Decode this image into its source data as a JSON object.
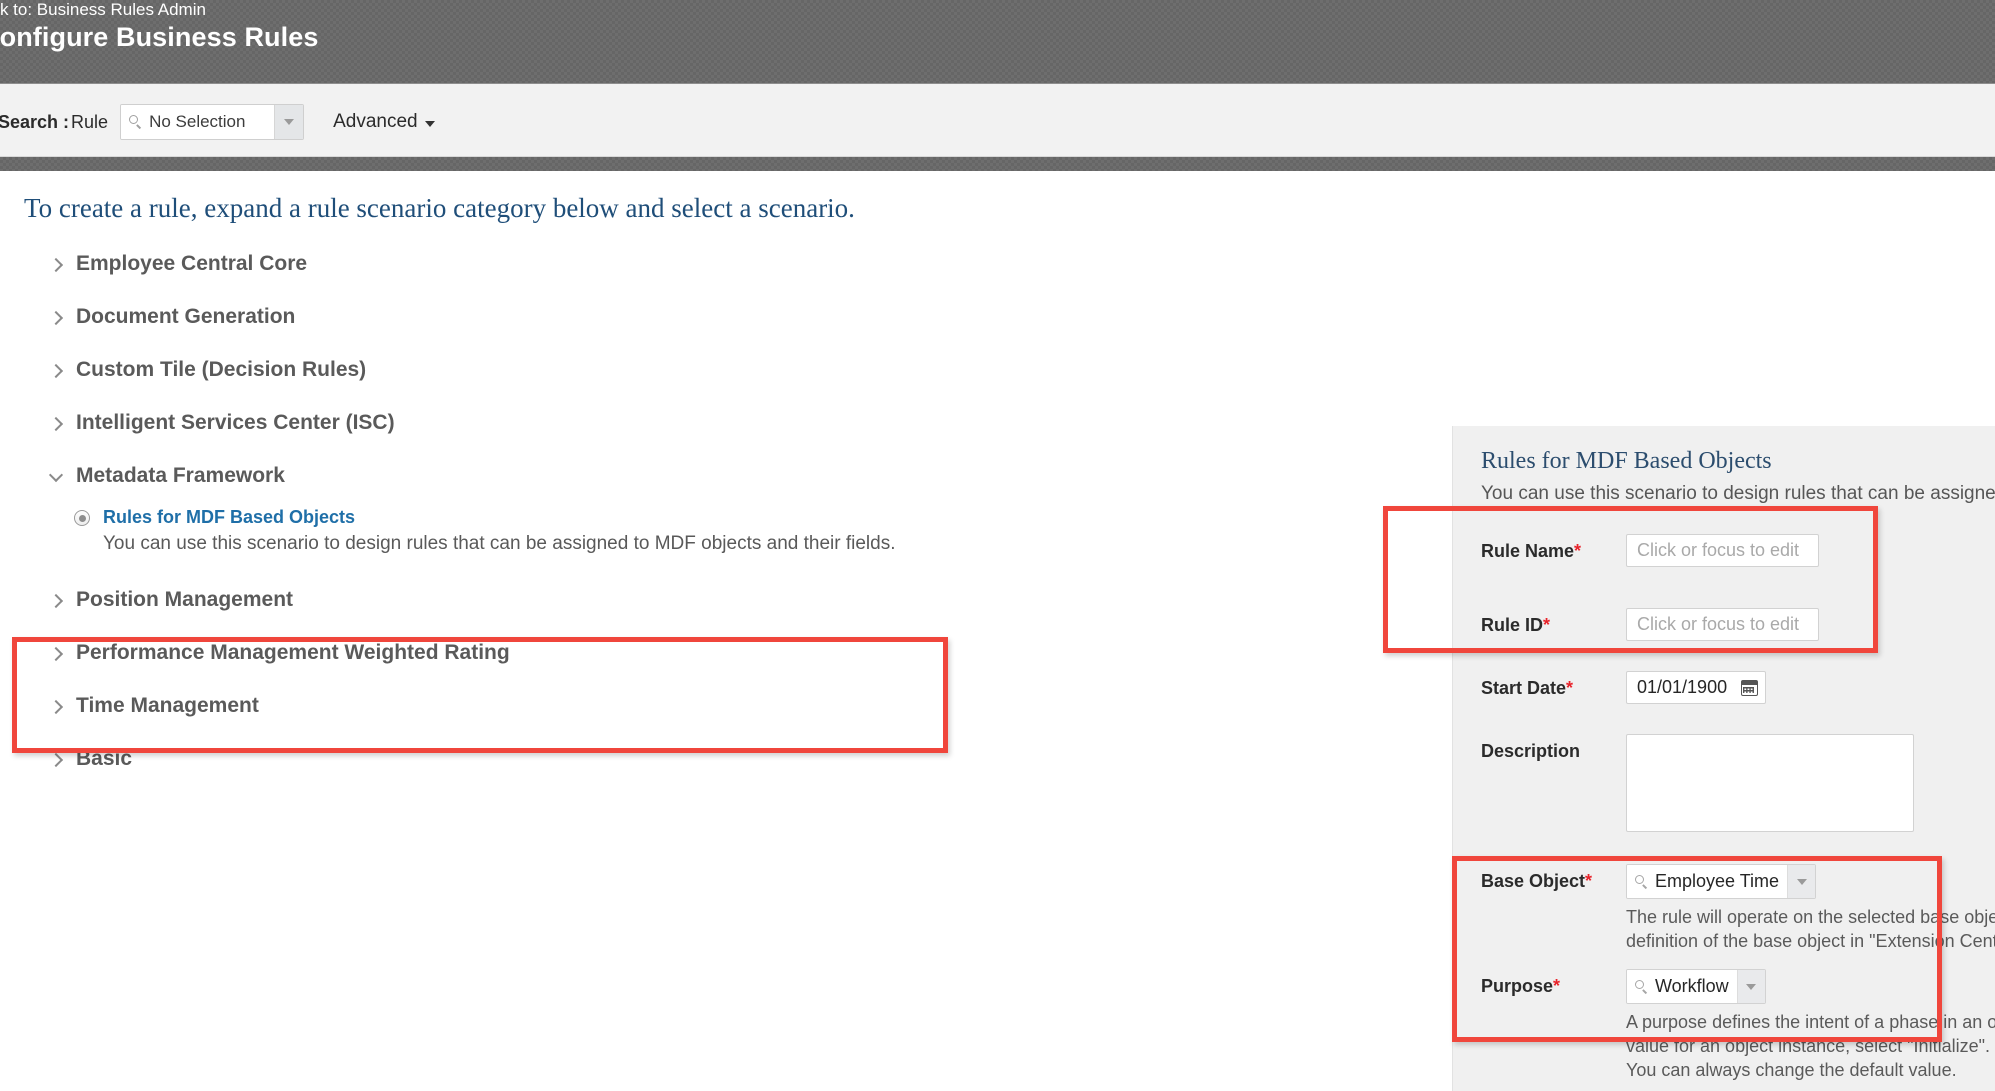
{
  "header": {
    "back_link": "ack to: Business Rules Admin",
    "title": "Configure Business Rules"
  },
  "search": {
    "label": "Search",
    "colon": ":",
    "object": "Rule",
    "selection_value": "No Selection",
    "search_icon": "search-icon",
    "dropdown_icon": "chevron-down-icon",
    "advanced_label": "Advanced"
  },
  "main": {
    "intro": "To create a rule, expand a rule scenario category below and select a scenario.",
    "tree": [
      {
        "label": "Employee Central Core",
        "expanded": false
      },
      {
        "label": "Document Generation",
        "expanded": false
      },
      {
        "label": "Custom Tile (Decision Rules)",
        "expanded": false
      },
      {
        "label": "Intelligent Services Center (ISC)",
        "expanded": false
      },
      {
        "label": "Metadata Framework",
        "expanded": true
      },
      {
        "label": "Position Management",
        "expanded": false
      },
      {
        "label": "Performance Management Weighted Rating",
        "expanded": false
      },
      {
        "label": "Time Management",
        "expanded": false
      },
      {
        "label": "Basic",
        "expanded": false
      }
    ],
    "scenario": {
      "title": "Rules for MDF Based Objects",
      "description": "You can use this scenario to design rules that can be assigned to MDF objects and their fields.",
      "selected": true
    }
  },
  "detail": {
    "heading": "Rules for MDF Based Objects",
    "subtitle": "You can use this scenario to design rules that can be assigned to M",
    "fields": {
      "rule_name": {
        "label": "Rule Name",
        "required": "*",
        "placeholder": "Click or focus to edit",
        "value": ""
      },
      "rule_id": {
        "label": "Rule ID",
        "required": "*",
        "placeholder": "Click or focus to edit",
        "value": ""
      },
      "start_date": {
        "label": "Start Date",
        "required": "*",
        "value": "01/01/1900",
        "icon": "calendar-icon"
      },
      "description": {
        "label": "Description",
        "value": ""
      },
      "base_object": {
        "label": "Base Object",
        "required": "*",
        "value": "Employee Time",
        "helper_line1": "The rule will operate on the selected base objec",
        "helper_line2": "definition of the base object in \"Extension Cente"
      },
      "purpose": {
        "label": "Purpose",
        "required": "*",
        "value": "Workflow",
        "helper_line1": "A purpose defines the intent of a phase in an ob",
        "helper_line2": "value for an object instance, select \"Initialize\". T",
        "helper_line3": "You can always change the default value."
      }
    }
  },
  "annotations": {
    "accent_color": "#f0463c",
    "boxes": [
      {
        "name": "metadata-framework-highlight"
      },
      {
        "name": "rule-name-id-highlight"
      },
      {
        "name": "base-object-purpose-highlight"
      }
    ]
  }
}
